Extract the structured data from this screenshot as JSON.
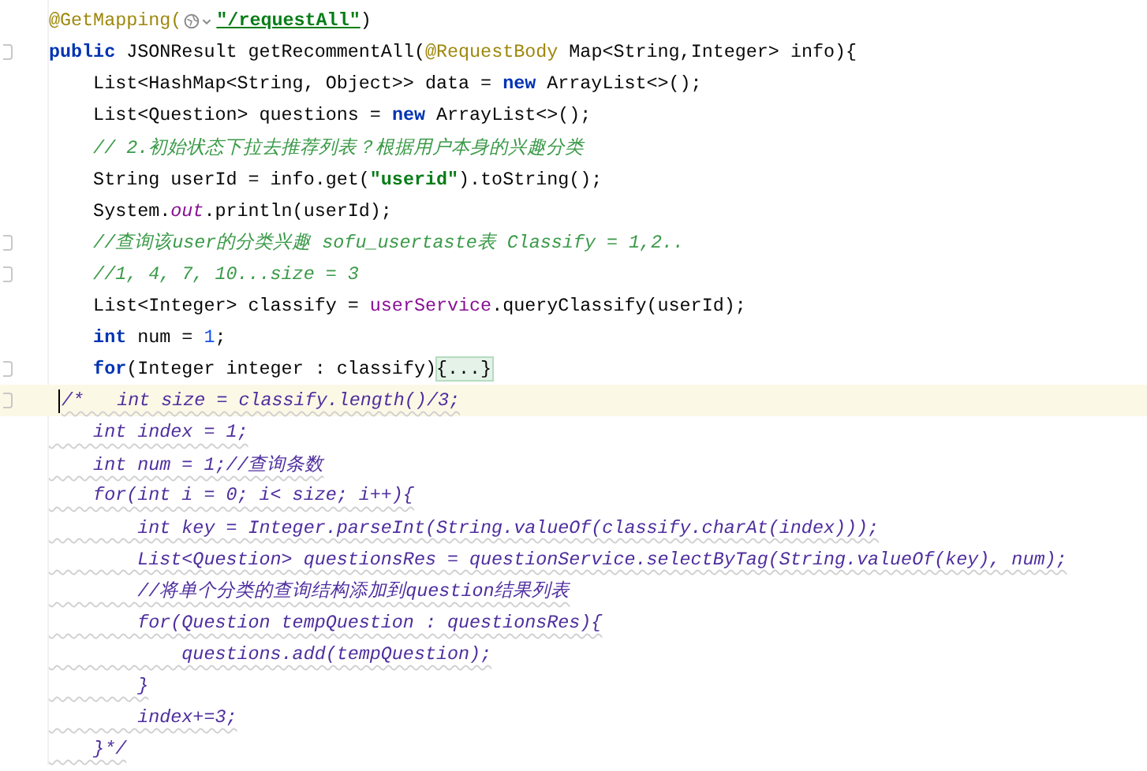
{
  "editor": {
    "lines": [
      {
        "fold_marker": false,
        "current": false,
        "tokens": [
          {
            "kind": "annotation",
            "text": "@GetMapping("
          },
          {
            "kind": "globe"
          },
          {
            "kind": "url",
            "text": "\"/requestAll\""
          },
          {
            "kind": "plain",
            "text": ")"
          }
        ]
      },
      {
        "fold_marker": true,
        "current": false,
        "tokens": [
          {
            "kind": "keyword",
            "text": "public"
          },
          {
            "kind": "plain",
            "text": " JSONResult getRecommentAll("
          },
          {
            "kind": "annotation",
            "text": "@RequestBody"
          },
          {
            "kind": "plain",
            "text": " Map<String,Integer> info){"
          }
        ]
      },
      {
        "fold_marker": false,
        "current": false,
        "tokens": [
          {
            "kind": "plain",
            "text": "    List<HashMap<String, Object>> data = "
          },
          {
            "kind": "keyword",
            "text": "new"
          },
          {
            "kind": "plain",
            "text": " ArrayList<>();"
          }
        ]
      },
      {
        "fold_marker": false,
        "current": false,
        "tokens": [
          {
            "kind": "plain",
            "text": "    List<Question> questions = "
          },
          {
            "kind": "keyword",
            "text": "new"
          },
          {
            "kind": "plain",
            "text": " ArrayList<>();"
          }
        ]
      },
      {
        "fold_marker": false,
        "current": false,
        "tokens": [
          {
            "kind": "comment",
            "text": "    // 2.初始状态下拉去推荐列表？根据用户本身的兴趣分类"
          }
        ]
      },
      {
        "fold_marker": false,
        "current": false,
        "tokens": [
          {
            "kind": "plain",
            "text": "    String userId = info.get("
          },
          {
            "kind": "string",
            "text": "\"userid\""
          },
          {
            "kind": "plain",
            "text": ").toString();"
          }
        ]
      },
      {
        "fold_marker": false,
        "current": false,
        "tokens": [
          {
            "kind": "plain",
            "text": "    System."
          },
          {
            "kind": "static",
            "text": "out"
          },
          {
            "kind": "plain",
            "text": ".println(userId);"
          }
        ]
      },
      {
        "fold_marker": true,
        "current": false,
        "tokens": [
          {
            "kind": "comment",
            "text": "    //查询该user的分类兴趣 sofu_usertaste表 Classify = 1,2.."
          }
        ]
      },
      {
        "fold_marker": true,
        "current": false,
        "tokens": [
          {
            "kind": "comment",
            "text": "    //1, 4, 7, 10...size = 3"
          }
        ]
      },
      {
        "fold_marker": false,
        "current": false,
        "tokens": [
          {
            "kind": "plain",
            "text": "    List<Integer> classify = "
          },
          {
            "kind": "field",
            "text": "userService"
          },
          {
            "kind": "plain",
            "text": ".queryClassify(userId);"
          }
        ]
      },
      {
        "fold_marker": false,
        "current": false,
        "tokens": [
          {
            "kind": "keyword",
            "text": "    int"
          },
          {
            "kind": "plain",
            "text": " num = "
          },
          {
            "kind": "number",
            "text": "1"
          },
          {
            "kind": "plain",
            "text": ";"
          }
        ]
      },
      {
        "fold_marker": true,
        "current": false,
        "tokens": [
          {
            "kind": "keyword",
            "text": "    for"
          },
          {
            "kind": "plain",
            "text": "(Integer integer : classify)"
          },
          {
            "kind": "folded",
            "text": "{...}"
          }
        ]
      },
      {
        "fold_marker": true,
        "current": true,
        "tokens": [
          {
            "kind": "block",
            "text": "/*   int size = classify.length()/3;"
          }
        ]
      },
      {
        "fold_marker": false,
        "current": false,
        "tokens": [
          {
            "kind": "block",
            "text": "    int index = 1;"
          }
        ]
      },
      {
        "fold_marker": false,
        "current": false,
        "tokens": [
          {
            "kind": "block",
            "text": "    int num = 1;//查询条数"
          }
        ]
      },
      {
        "fold_marker": false,
        "current": false,
        "tokens": [
          {
            "kind": "block",
            "text": "    for(int i = 0; i< size; i++){"
          }
        ]
      },
      {
        "fold_marker": false,
        "current": false,
        "tokens": [
          {
            "kind": "block",
            "text": "        int key = Integer.parseInt(String.valueOf(classify.charAt(index)));"
          }
        ]
      },
      {
        "fold_marker": false,
        "current": false,
        "tokens": [
          {
            "kind": "block",
            "text": "        List<Question> questionsRes = questionService.selectByTag(String.valueOf(key), num);"
          }
        ]
      },
      {
        "fold_marker": false,
        "current": false,
        "tokens": [
          {
            "kind": "block",
            "text": "        //将单个分类的查询结构添加到question结果列表"
          }
        ]
      },
      {
        "fold_marker": false,
        "current": false,
        "tokens": [
          {
            "kind": "block",
            "text": "        for(Question tempQuestion : questionsRes){"
          }
        ]
      },
      {
        "fold_marker": false,
        "current": false,
        "tokens": [
          {
            "kind": "block",
            "text": "            questions.add(tempQuestion);"
          }
        ]
      },
      {
        "fold_marker": false,
        "current": false,
        "tokens": [
          {
            "kind": "block",
            "text": "        }"
          }
        ]
      },
      {
        "fold_marker": false,
        "current": false,
        "tokens": [
          {
            "kind": "block",
            "text": "        index+=3;"
          }
        ]
      },
      {
        "fold_marker": false,
        "current": false,
        "tokens": [
          {
            "kind": "block",
            "text": "    }*/"
          }
        ]
      }
    ]
  }
}
